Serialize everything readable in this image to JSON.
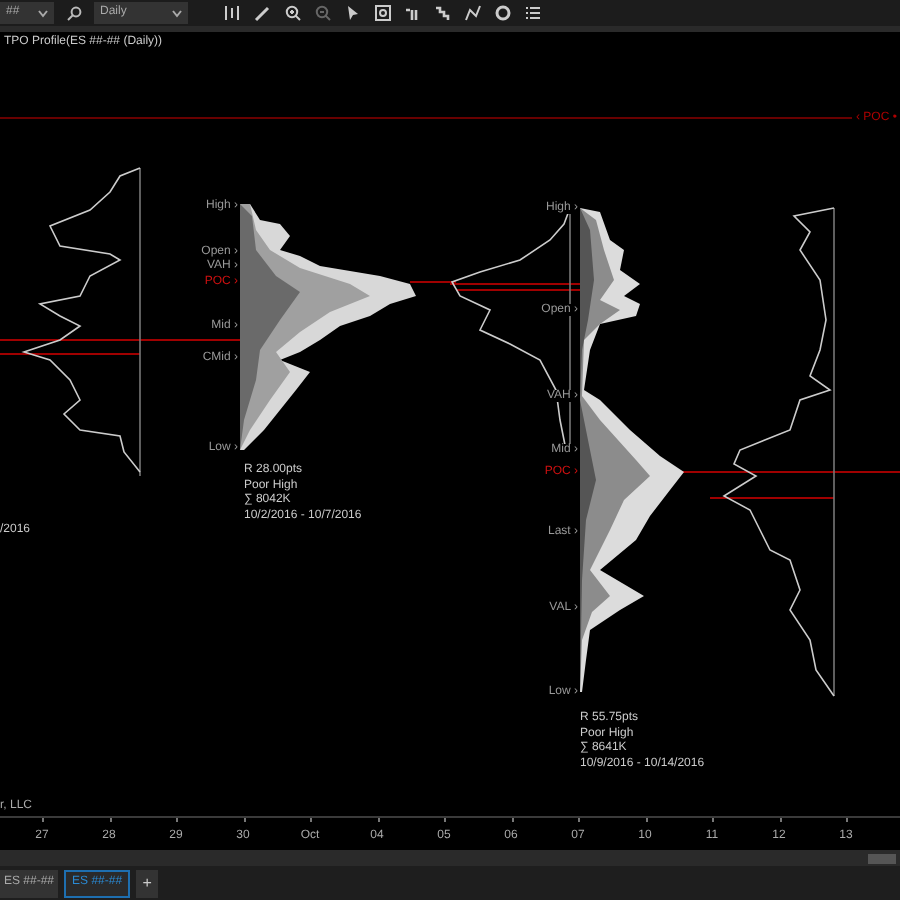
{
  "toolbar": {
    "symbol": "##",
    "interval": "Daily"
  },
  "chart": {
    "title": "TPO Profile(ES ##-## (Daily))",
    "poc_marker": "‹ POC •",
    "partial_date": "/2016",
    "copyright": "r, LLC",
    "profiles": [
      {
        "labels": [
          {
            "text": "High ›",
            "kind": "normal"
          },
          {
            "text": "Open ›",
            "kind": "normal"
          },
          {
            "text": "VAH ›",
            "kind": "normal"
          },
          {
            "text": "POC ›",
            "kind": "poc"
          },
          {
            "text": "Mid ›",
            "kind": "normal"
          },
          {
            "text": "CMid ›",
            "kind": "normal"
          },
          {
            "text": "Low ›",
            "kind": "normal"
          }
        ],
        "info": [
          "R 28.00pts",
          "Poor High",
          "∑ 8042K",
          "10/2/2016 - 10/7/2016"
        ]
      },
      {
        "labels": [
          {
            "text": "High ›",
            "kind": "normal"
          },
          {
            "text": "Open ›",
            "kind": "normal"
          },
          {
            "text": "VAH ›",
            "kind": "normal"
          },
          {
            "text": "Mid ›",
            "kind": "normal"
          },
          {
            "text": "POC ›",
            "kind": "poc"
          },
          {
            "text": "Last ›",
            "kind": "normal"
          },
          {
            "text": "VAL ›",
            "kind": "normal"
          },
          {
            "text": "Low ›",
            "kind": "normal"
          }
        ],
        "info": [
          "R 55.75pts",
          "Poor High",
          "∑ 8641K",
          "10/9/2016 - 10/14/2016"
        ]
      }
    ]
  },
  "x_axis": [
    "27",
    "28",
    "29",
    "30",
    "Oct",
    "04",
    "05",
    "06",
    "07",
    "10",
    "11",
    "12",
    "13"
  ],
  "tabs": [
    {
      "label": "ES ##-##",
      "selected": false
    },
    {
      "label": "ES ##-##",
      "selected": true
    }
  ],
  "add_tab": "+"
}
